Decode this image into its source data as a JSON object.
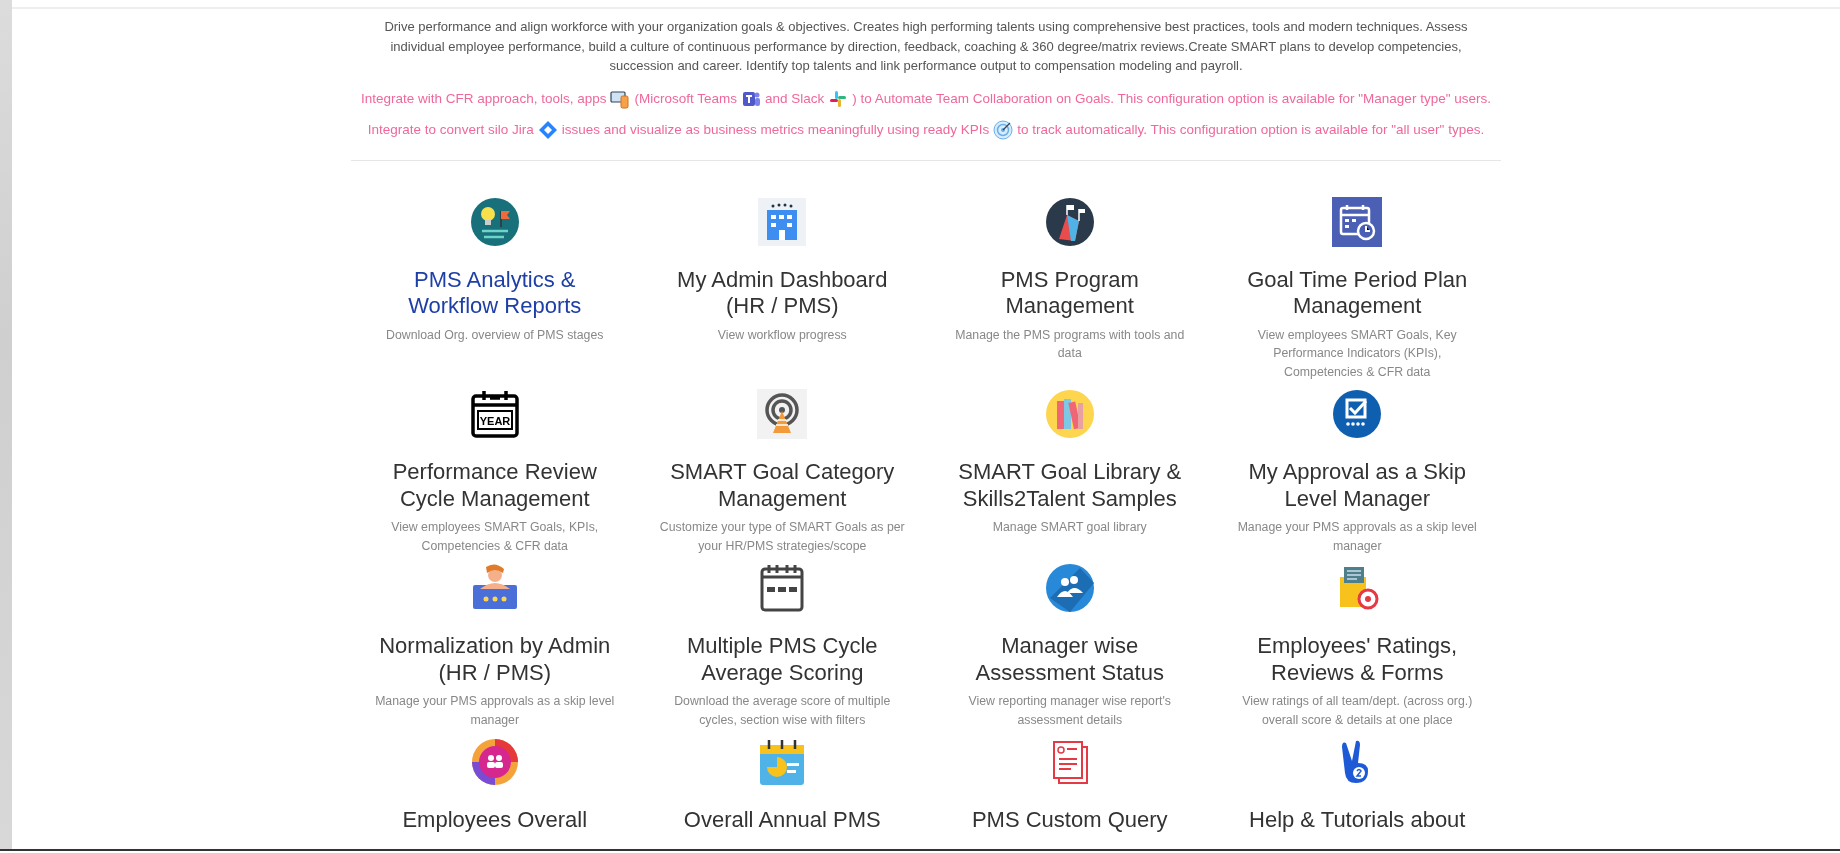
{
  "intro": "Drive performance and align workforce with your organization goals & objectives. Creates high performing talents using comprehensive best practices, tools and modern techniques. Assess individual employee performance, build a culture of continuous performance by direction, feedback, coaching & 360 degree/matrix reviews.Create SMART plans to develop competencies, succession and career. Identify top talents and link performance output to compensation modeling and payroll.",
  "integrations": [
    {
      "parts": [
        "Integrate with CFR approach, tools, apps",
        "(Microsoft Teams",
        "and Slack",
        ") to Automate Team Collaboration on Goals. This configuration option is available for \"Manager type\" users."
      ]
    },
    {
      "parts": [
        "Integrate to convert silo Jira",
        "issues and visualize as business metrics meaningfully using ready KPIs",
        "to track automatically. This configuration option is available for \"all user\" types."
      ]
    }
  ],
  "tiles": [
    {
      "title": "PMS Analytics & Workflow Reports",
      "description": "Download Org. overview of PMS stages",
      "hovered": true
    },
    {
      "title": "My Admin Dashboard (HR / PMS)",
      "description": "View workflow progress",
      "hovered": false
    },
    {
      "title": "PMS Program Management",
      "description": "Manage the PMS programs with tools and data",
      "hovered": false
    },
    {
      "title": "Goal Time Period Plan Management",
      "description": "View employees SMART Goals, Key Performance Indicators (KPIs), Competencies & CFR data",
      "hovered": false
    },
    {
      "title": "Performance Review Cycle Management",
      "description": "View employees SMART Goals, KPIs, Competencies & CFR data",
      "hovered": false,
      "icon_text": "YEAR"
    },
    {
      "title": "SMART Goal Category Management",
      "description": "Customize your type of SMART Goals as per your HR/PMS strategies/scope",
      "hovered": false
    },
    {
      "title": "SMART Goal Library & Skills2Talent Samples",
      "description": "Manage SMART goal library",
      "hovered": false
    },
    {
      "title": "My Approval as a Skip Level Manager",
      "description": "Manage your PMS approvals as a skip level manager",
      "hovered": false
    },
    {
      "title": "Normalization by Admin (HR / PMS)",
      "description": "Manage your PMS approvals as a skip level manager",
      "hovered": false
    },
    {
      "title": "Multiple PMS Cycle Average Scoring",
      "description": "Download the average score of multiple cycles, section wise with filters",
      "hovered": false
    },
    {
      "title": "Manager wise Assessment Status",
      "description": "View reporting manager wise report's assessment details",
      "hovered": false
    },
    {
      "title": "Employees' Ratings, Reviews & Forms",
      "description": "View ratings of all team/dept. (across org.) overall score & details at one place",
      "hovered": false
    },
    {
      "title": "Employees Overall",
      "hovered": false
    },
    {
      "title": "Overall Annual PMS",
      "hovered": false
    },
    {
      "title": "PMS Custom Query",
      "hovered": false
    },
    {
      "title": "Help & Tutorials about",
      "hovered": false
    }
  ]
}
